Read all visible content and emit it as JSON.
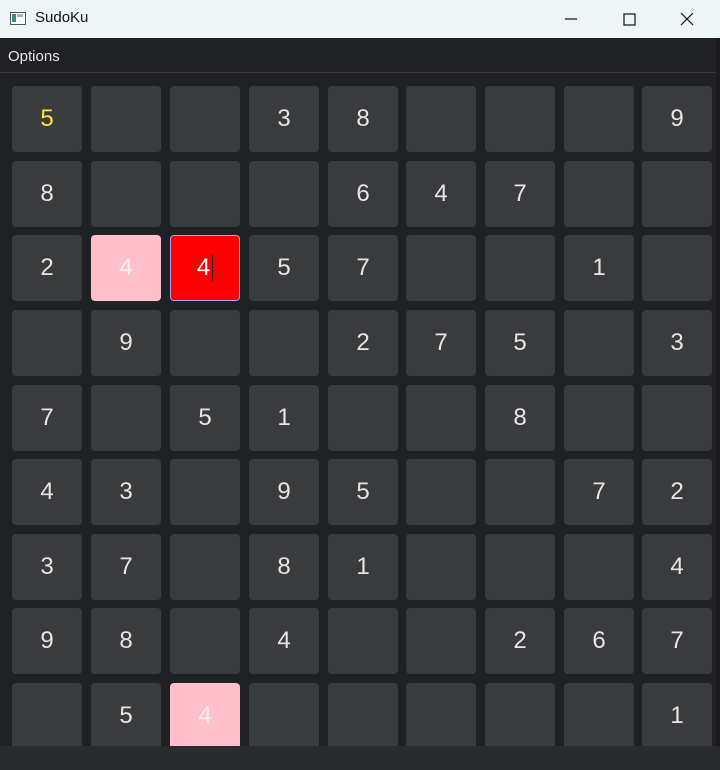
{
  "window": {
    "title": "SudoKu",
    "icons": {
      "app": "app-window-icon",
      "minimize": "minimize-icon",
      "maximize": "maximize-icon",
      "close": "close-icon"
    }
  },
  "menu": {
    "options_label": "Options"
  },
  "colors": {
    "background": "#202124",
    "cell": "#3a3b3d",
    "given_digit": "#e6e6e6",
    "highlight_digit": "#ffe23a",
    "conflict_cell": "#ffc0cb",
    "selected_error_cell": "#ff0000"
  },
  "board": {
    "rows": [
      [
        "5",
        "",
        "",
        "3",
        "8",
        "",
        "",
        "",
        "9"
      ],
      [
        "8",
        "",
        "",
        "",
        "6",
        "4",
        "7",
        "",
        ""
      ],
      [
        "2",
        "4",
        "4",
        "5",
        "7",
        "",
        "",
        "1",
        ""
      ],
      [
        "",
        "9",
        "",
        "",
        "2",
        "7",
        "5",
        "",
        "3"
      ],
      [
        "7",
        "",
        "5",
        "1",
        "",
        "",
        "8",
        "",
        ""
      ],
      [
        "4",
        "3",
        "",
        "9",
        "5",
        "",
        "",
        "7",
        "2"
      ],
      [
        "3",
        "7",
        "",
        "8",
        "1",
        "",
        "",
        "",
        "4"
      ],
      [
        "9",
        "8",
        "",
        "4",
        "",
        "",
        "2",
        "6",
        "7"
      ],
      [
        "",
        "5",
        "4",
        "",
        "",
        "",
        "",
        "",
        "1"
      ]
    ],
    "states": [
      [
        "yellow",
        "",
        "",
        "",
        "",
        "",
        "",
        "",
        ""
      ],
      [
        "",
        "",
        "",
        "",
        "",
        "",
        "",
        "",
        ""
      ],
      [
        "",
        "pink",
        "red",
        "",
        "",
        "",
        "",
        "",
        ""
      ],
      [
        "",
        "",
        "",
        "",
        "",
        "",
        "",
        "",
        ""
      ],
      [
        "",
        "",
        "",
        "",
        "",
        "",
        "",
        "",
        ""
      ],
      [
        "",
        "",
        "",
        "",
        "",
        "",
        "",
        "",
        ""
      ],
      [
        "",
        "",
        "",
        "",
        "",
        "",
        "",
        "",
        ""
      ],
      [
        "",
        "",
        "",
        "",
        "",
        "",
        "",
        "",
        ""
      ],
      [
        "",
        "",
        "pink",
        "",
        "",
        "",
        "",
        "",
        ""
      ]
    ],
    "editing_cell": {
      "row": 2,
      "col": 2
    }
  }
}
